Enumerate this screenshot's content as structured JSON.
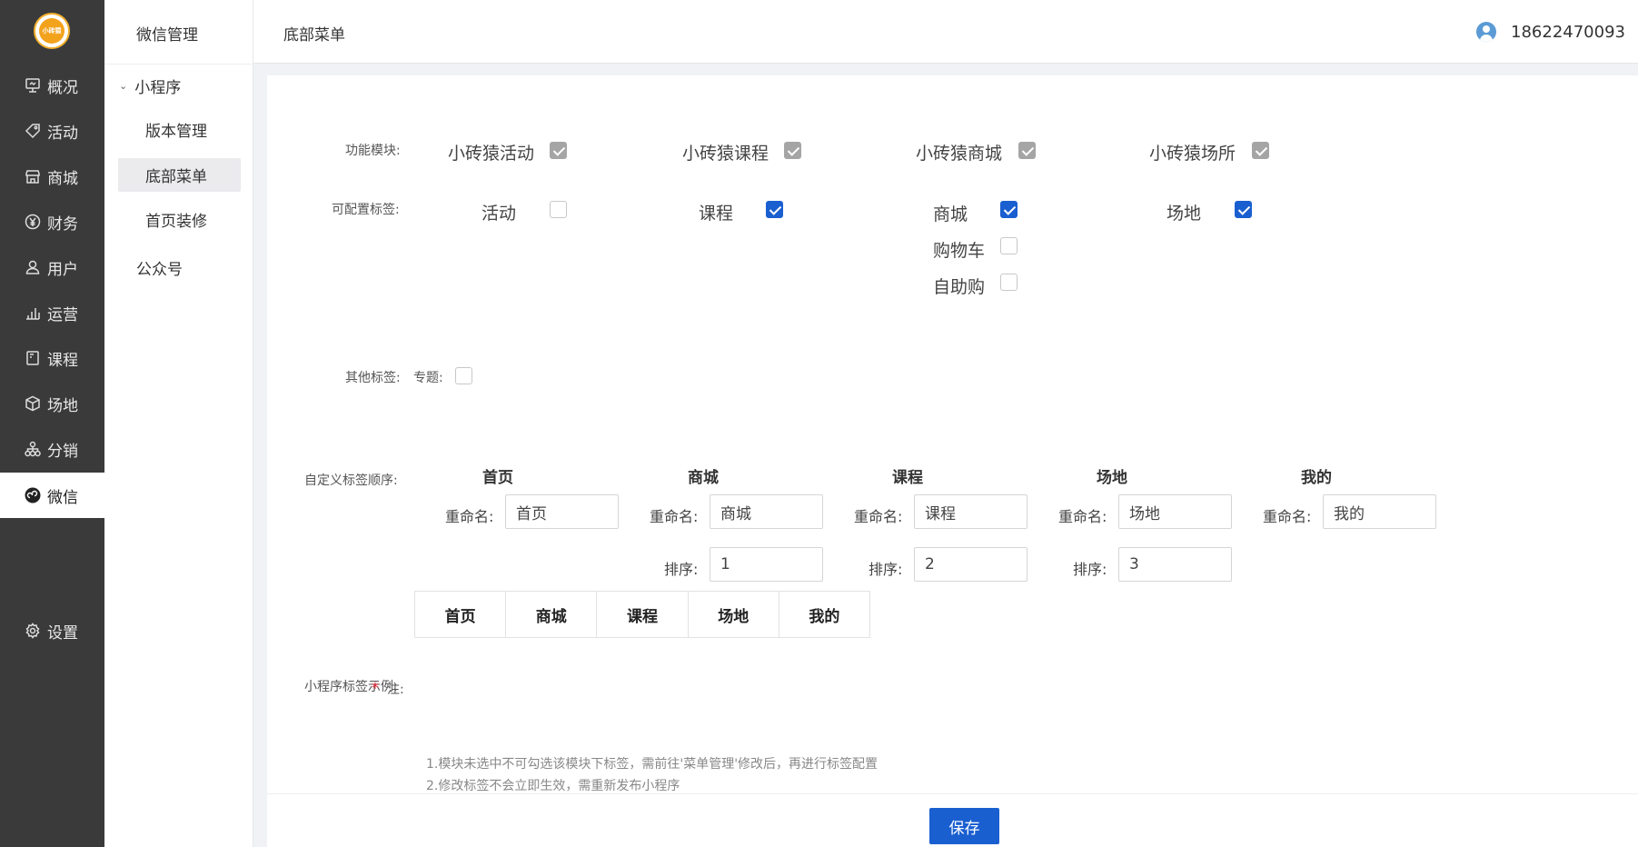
{
  "nav": {
    "logo_text": "小砖猿",
    "items": [
      {
        "label": "概况",
        "icon": "monitor-icon"
      },
      {
        "label": "活动",
        "icon": "tag-icon"
      },
      {
        "label": "商城",
        "icon": "store-icon"
      },
      {
        "label": "财务",
        "icon": "yen-icon"
      },
      {
        "label": "用户",
        "icon": "user-icon"
      },
      {
        "label": "运营",
        "icon": "bar-chart-icon"
      },
      {
        "label": "课程",
        "icon": "book-icon"
      },
      {
        "label": "场地",
        "icon": "cube-icon"
      },
      {
        "label": "分销",
        "icon": "network-icon"
      },
      {
        "label": "微信",
        "icon": "wechat-icon"
      },
      {
        "label": "设置",
        "icon": "gear-icon"
      }
    ],
    "active": "微信"
  },
  "subnav": {
    "title": "微信管理",
    "group": "小程序",
    "items": [
      "版本管理",
      "底部菜单",
      "首页装修"
    ],
    "active": "底部菜单",
    "other": "公众号"
  },
  "header": {
    "title": "底部菜单",
    "phone": "18622470093"
  },
  "form": {
    "modules_label": "功能模块:",
    "modules": [
      {
        "label": "小砖猿活动",
        "checked": true,
        "disabled": true
      },
      {
        "label": "小砖猿课程",
        "checked": true,
        "disabled": true
      },
      {
        "label": "小砖猿商城",
        "checked": true,
        "disabled": true
      },
      {
        "label": "小砖猿场所",
        "checked": true,
        "disabled": true
      }
    ],
    "config_label": "可配置标签:",
    "config": [
      {
        "label": "活动",
        "checked": false
      },
      {
        "label": "课程",
        "checked": true
      },
      {
        "label": "商城",
        "checked": true
      },
      {
        "label": "购物车",
        "checked": false
      },
      {
        "label": "自助购",
        "checked": false
      },
      {
        "label": "场地",
        "checked": true
      }
    ],
    "other_label": "其他标签:",
    "other_item": "专题:",
    "order_label": "自定义标签顺序:",
    "rename_label": "重命名:",
    "sort_label": "排序:",
    "columns": [
      {
        "title": "首页",
        "rename": "首页",
        "sort": null
      },
      {
        "title": "商城",
        "rename": "商城",
        "sort": "1"
      },
      {
        "title": "课程",
        "rename": "课程",
        "sort": "2"
      },
      {
        "title": "场地",
        "rename": "场地",
        "sort": "3"
      },
      {
        "title": "我的",
        "rename": "我的",
        "sort": null
      }
    ],
    "preview_label": "小程序标签示例:",
    "preview_tabs": [
      "首页",
      "商城",
      "课程",
      "场地",
      "我的"
    ],
    "note_star": "*",
    "note_label": "注:",
    "notes": [
      "1.模块未选中不可勾选该模块下标签，需前往'菜单管理'修改后，再进行标签配置",
      "2.修改标签不会立即生效，需重新发布小程序"
    ],
    "save_label": "保存"
  }
}
